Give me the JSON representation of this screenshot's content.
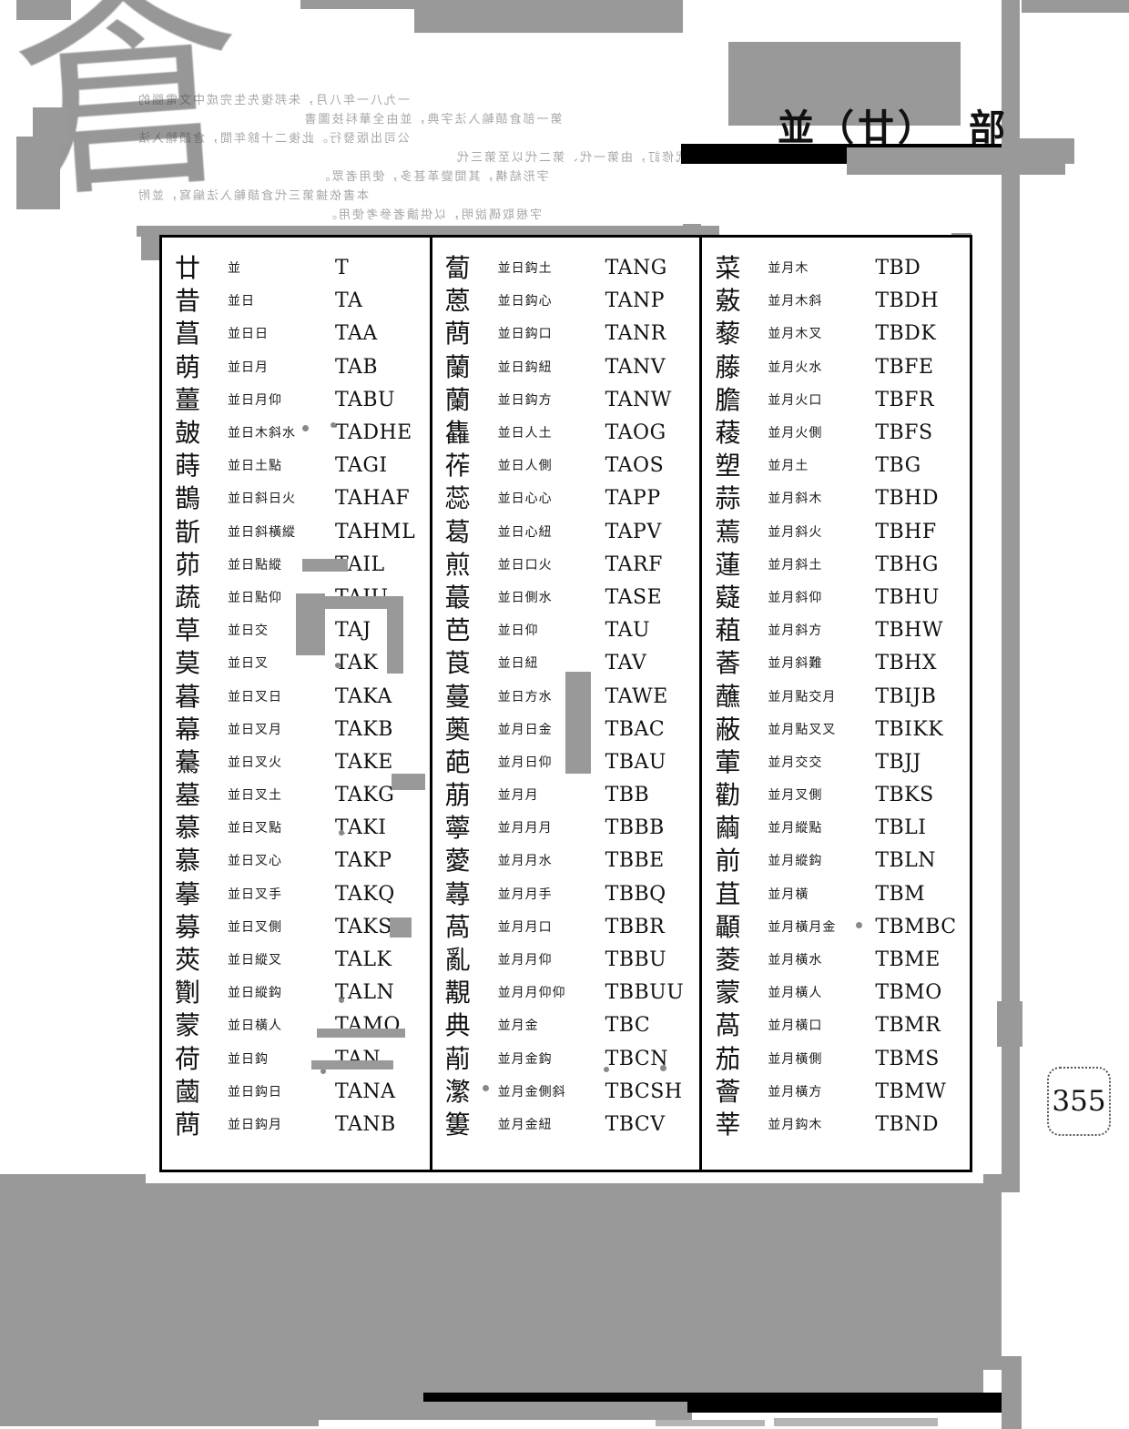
{
  "header": {
    "title": "並（廿）",
    "section": "部"
  },
  "page": {
    "number": "355"
  },
  "watermark": {
    "seal_char": "倉"
  },
  "bleed_through": {
    "note": "faint mirrored bleed-through text from reverse page (illegible)",
    "lines": [
      "一九八一年八月，朱邦復先生完成中文電腦的",
      "第一部倉頡輸入法字典，並由全華科技圖書",
      "公司出版發行。此後二十餘年間，倉頡輸入法",
      "歷經三代修訂，由第一代、第二代以至第三代",
      "字形結構，其間變革甚多，使用者眾。",
      "本書依據第三代倉頡輸入法編寫，並附",
      "字根取碼說明，以供讀者參考使用。"
    ]
  },
  "columns": [
    {
      "id": "column-1",
      "rows": [
        {
          "glyph": "廿",
          "radicals": "並",
          "code": "T"
        },
        {
          "glyph": "昔",
          "radicals": "並日",
          "code": "TA"
        },
        {
          "glyph": "菖",
          "radicals": "並日日",
          "code": "TAA"
        },
        {
          "glyph": "萌",
          "radicals": "並日月",
          "code": "TAB"
        },
        {
          "glyph": "薑",
          "radicals": "並日月仰",
          "code": "TABU"
        },
        {
          "glyph": "皷",
          "radicals": "並日木斜水",
          "code": "TADHE"
        },
        {
          "glyph": "蒔",
          "radicals": "並日土點",
          "code": "TAGI"
        },
        {
          "glyph": "鵲",
          "radicals": "並日斜日火",
          "code": "TAHAF"
        },
        {
          "glyph": "斮",
          "radicals": "並日斜橫縱",
          "code": "TAHML"
        },
        {
          "glyph": "茆",
          "radicals": "並日點縱",
          "code": "TAIL"
        },
        {
          "glyph": "蔬",
          "radicals": "並日點仰",
          "code": "TAIU"
        },
        {
          "glyph": "草",
          "radicals": "並日交",
          "code": "TAJ"
        },
        {
          "glyph": "莫",
          "radicals": "並日叉",
          "code": "TAK"
        },
        {
          "glyph": "暮",
          "radicals": "並日叉日",
          "code": "TAKA"
        },
        {
          "glyph": "幕",
          "radicals": "並日叉月",
          "code": "TAKB"
        },
        {
          "glyph": "驀",
          "radicals": "並日叉火",
          "code": "TAKE"
        },
        {
          "glyph": "墓",
          "radicals": "並日叉土",
          "code": "TAKG"
        },
        {
          "glyph": "慕",
          "radicals": "並日叉點",
          "code": "TAKI"
        },
        {
          "glyph": "慕",
          "radicals": "並日叉心",
          "code": "TAKP"
        },
        {
          "glyph": "摹",
          "radicals": "並日叉手",
          "code": "TAKQ"
        },
        {
          "glyph": "募",
          "radicals": "並日叉側",
          "code": "TAKS"
        },
        {
          "glyph": "莢",
          "radicals": "並日縱叉",
          "code": "TALK"
        },
        {
          "glyph": "劗",
          "radicals": "並日縱鈎",
          "code": "TALN"
        },
        {
          "glyph": "蒙",
          "radicals": "並日橫人",
          "code": "TAMO"
        },
        {
          "glyph": "荷",
          "radicals": "並日鈎",
          "code": "TAN"
        },
        {
          "glyph": "蔮",
          "radicals": "並日鈎日",
          "code": "TANA"
        },
        {
          "glyph": "蔄",
          "radicals": "並日鈎月",
          "code": "TANB"
        }
      ]
    },
    {
      "id": "column-2",
      "rows": [
        {
          "glyph": "蔔",
          "radicals": "並日鈎土",
          "code": "TANG"
        },
        {
          "glyph": "蒽",
          "radicals": "並日鈎心",
          "code": "TANP"
        },
        {
          "glyph": "蔄",
          "radicals": "並日鈎口",
          "code": "TANR"
        },
        {
          "glyph": "蘭",
          "radicals": "並日鈎紐",
          "code": "TANV"
        },
        {
          "glyph": "蘭",
          "radicals": "並日鈎方",
          "code": "TANW"
        },
        {
          "glyph": "雥",
          "radicals": "並日人土",
          "code": "TAOG"
        },
        {
          "glyph": "莋",
          "radicals": "並日人側",
          "code": "TAOS"
        },
        {
          "glyph": "蕊",
          "radicals": "並日心心",
          "code": "TAPP"
        },
        {
          "glyph": "葛",
          "radicals": "並日心紐",
          "code": "TAPV"
        },
        {
          "glyph": "煎",
          "radicals": "並日口火",
          "code": "TARF"
        },
        {
          "glyph": "蕞",
          "radicals": "並日側水",
          "code": "TASE"
        },
        {
          "glyph": "芭",
          "radicals": "並日仰",
          "code": "TAU"
        },
        {
          "glyph": "莨",
          "radicals": "並日紐",
          "code": "TAV"
        },
        {
          "glyph": "蔓",
          "radicals": "並日方水",
          "code": "TAWE"
        },
        {
          "glyph": "薁",
          "radicals": "並月日金",
          "code": "TBAC"
        },
        {
          "glyph": "葩",
          "radicals": "並月日仰",
          "code": "TBAU"
        },
        {
          "glyph": "萠",
          "radicals": "並月月",
          "code": "TBB"
        },
        {
          "glyph": "薴",
          "radicals": "並月月月",
          "code": "TBBB"
        },
        {
          "glyph": "薆",
          "radicals": "並月月水",
          "code": "TBBE"
        },
        {
          "glyph": "蕁",
          "radicals": "並月月手",
          "code": "TBBQ"
        },
        {
          "glyph": "萵",
          "radicals": "並月月口",
          "code": "TBBR"
        },
        {
          "glyph": "亂",
          "radicals": "並月月仰",
          "code": "TBBU"
        },
        {
          "glyph": "覯",
          "radicals": "並月月仰仰",
          "code": "TBBUU"
        },
        {
          "glyph": "典",
          "radicals": "並月金",
          "code": "TBC"
        },
        {
          "glyph": "萷",
          "radicals": "並月金鈎",
          "code": "TBCN"
        },
        {
          "glyph": "瀿",
          "radicals": "並月金側斜",
          "code": "TBCSH"
        },
        {
          "glyph": "簍",
          "radicals": "並月金紐",
          "code": "TBCV"
        }
      ]
    },
    {
      "id": "column-3",
      "rows": [
        {
          "glyph": "菜",
          "radicals": "並月木",
          "code": "TBD"
        },
        {
          "glyph": "薂",
          "radicals": "並月木斜",
          "code": "TBDH"
        },
        {
          "glyph": "藜",
          "radicals": "並月木叉",
          "code": "TBDK"
        },
        {
          "glyph": "藤",
          "radicals": "並月火水",
          "code": "TBFE"
        },
        {
          "glyph": "膽",
          "radicals": "並月火口",
          "code": "TBFR"
        },
        {
          "glyph": "薐",
          "radicals": "並月火側",
          "code": "TBFS"
        },
        {
          "glyph": "塑",
          "radicals": "並月土",
          "code": "TBG"
        },
        {
          "glyph": "蒜",
          "radicals": "並月斜木",
          "code": "TBHD"
        },
        {
          "glyph": "蔫",
          "radicals": "並月斜火",
          "code": "TBHF"
        },
        {
          "glyph": "蓮",
          "radicals": "並月斜土",
          "code": "TBHG"
        },
        {
          "glyph": "薿",
          "radicals": "並月斜仰",
          "code": "TBHU"
        },
        {
          "glyph": "蒩",
          "radicals": "並月斜方",
          "code": "TBHW"
        },
        {
          "glyph": "萫",
          "radicals": "並月斜難",
          "code": "TBHX"
        },
        {
          "glyph": "蘸",
          "radicals": "並月點交月",
          "code": "TBIJB"
        },
        {
          "glyph": "蔽",
          "radicals": "並月點叉叉",
          "code": "TBIKK"
        },
        {
          "glyph": "葷",
          "radicals": "並月交交",
          "code": "TBJJ"
        },
        {
          "glyph": "勸",
          "radicals": "並月叉側",
          "code": "TBKS"
        },
        {
          "glyph": "繭",
          "radicals": "並月縱點",
          "code": "TBLI"
        },
        {
          "glyph": "前",
          "radicals": "並月縱鈎",
          "code": "TBLN"
        },
        {
          "glyph": "苴",
          "radicals": "並月橫",
          "code": "TBM"
        },
        {
          "glyph": "顳",
          "radicals": "並月橫月金",
          "code": "TBMBC"
        },
        {
          "glyph": "菱",
          "radicals": "並月橫水",
          "code": "TBME"
        },
        {
          "glyph": "蒙",
          "radicals": "並月橫人",
          "code": "TBMO"
        },
        {
          "glyph": "萵",
          "radicals": "並月橫口",
          "code": "TBMR"
        },
        {
          "glyph": "茄",
          "radicals": "並月橫側",
          "code": "TBMS"
        },
        {
          "glyph": "薈",
          "radicals": "並月橫方",
          "code": "TBMW"
        },
        {
          "glyph": "莘",
          "radicals": "並月鈎木",
          "code": "TBND"
        }
      ]
    }
  ],
  "artifacts": {
    "note": "gray scanner smudge blocks and black bar streaks overlaying the page"
  }
}
